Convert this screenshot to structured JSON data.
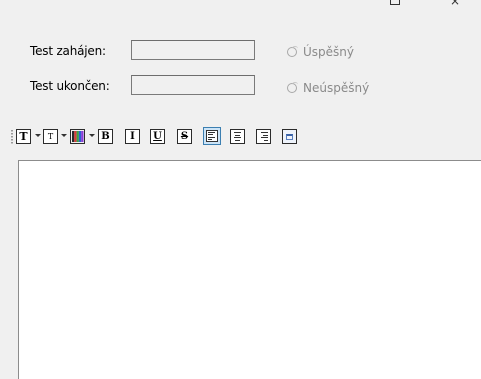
{
  "window": {
    "close_glyph": "×"
  },
  "form": {
    "start_label": "Test zahájen:",
    "start_value": "",
    "end_label": "Test ukončen:",
    "end_value": "",
    "success_label": "Úspěšný",
    "failure_label": "Neúspěšný"
  },
  "toolbar": {
    "font_glyph": "T",
    "font_size_glyph": "T",
    "bold_glyph": "B",
    "italic_glyph": "I",
    "underline_glyph": "U",
    "strike_glyph": "S",
    "active_alignment": "left",
    "color_bars": [
      "#2a2a2a",
      "#d83b3b",
      "#3aa346",
      "#2f5fd0",
      "#8a3bd8"
    ]
  },
  "editor": {
    "content": ""
  }
}
